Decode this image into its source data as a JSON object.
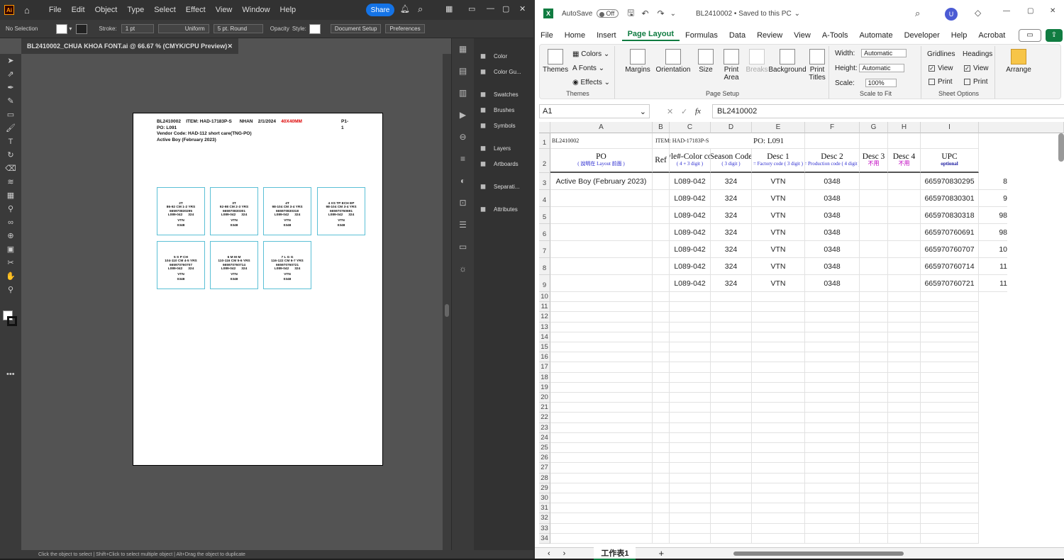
{
  "illustrator": {
    "logo": "Ai",
    "menu": [
      "File",
      "Edit",
      "Object",
      "Type",
      "Select",
      "Effect",
      "View",
      "Window",
      "Help"
    ],
    "share_label": "Share",
    "control": {
      "selection": "No Selection",
      "stroke_label": "Stroke:",
      "stroke_value": "1 pt",
      "stroke_style": "Uniform",
      "brush": "5 pt. Round",
      "opacity_label": "Opacity",
      "style_label": "Style:",
      "doc_setup": "Document Setup",
      "preferences": "Preferences"
    },
    "doc_tab": "BL2410002_CHUA KHOA FONT.ai @ 66.67 % (CMYK/CPU Preview)",
    "panels": [
      {
        "icon": "color-icon",
        "label": "Color"
      },
      {
        "icon": "color-guide-icon",
        "label": "Color Gu..."
      },
      {
        "icon": "swatches-icon",
        "label": "Swatches"
      },
      {
        "icon": "brushes-icon",
        "label": "Brushes"
      },
      {
        "icon": "symbols-icon",
        "label": "Symbols"
      },
      {
        "icon": "layers-icon",
        "label": "Layers"
      },
      {
        "icon": "artboards-icon",
        "label": "Artboards"
      },
      {
        "icon": "separations-icon",
        "label": "Separati..."
      },
      {
        "icon": "attributes-icon",
        "label": "Attributes"
      }
    ],
    "status": "Click the object to select  |  Shift+Click to select multiple object  |  Alt+Drag the object to duplicate",
    "artboard": {
      "line1_bl": "BL2410002",
      "line1_item": "ITEM: HAD-17183P-S",
      "line1_nhan": "NHAN",
      "line1_date": "2/1/2024",
      "line1_size": "40X40MM",
      "line1_page": "P1-1",
      "line2": "PO: L091",
      "line3": "Vendor Code: HAD-112 short care(TNG-PO)",
      "line4": "Active Boy (February 2023)",
      "labels": [
        {
          "size": "2T",
          "range": "86-92 CM 1-2 YRS",
          "upc": "665970830295",
          "style": "L089-042",
          "season": "324",
          "vtn": "VTN",
          "code": "0348"
        },
        {
          "size": "3T",
          "range": "92-98 CM 2-3 YRS",
          "upc": "665970830301",
          "style": "L089-042",
          "season": "324",
          "vtn": "VTN",
          "code": "0348"
        },
        {
          "size": "4T",
          "range": "98-104 CM 3-4 YRS",
          "upc": "665970830318",
          "style": "L089-042",
          "season": "324",
          "vtn": "VTN",
          "code": "0348"
        },
        {
          "size": "4 XS TP ECH EP",
          "range": "98-104 CM 3-4 YRS",
          "upc": "665970760691",
          "style": "L089-042",
          "season": "324",
          "vtn": "VTN",
          "code": "0348"
        },
        {
          "size": "5 S P CH",
          "range": "104-110 CM 4-5 YRS",
          "upc": "665970760707",
          "style": "L089-042",
          "season": "324",
          "vtn": "VTN",
          "code": "0348"
        },
        {
          "size": "6 M M M",
          "range": "110-116 CM 5-6 YRS",
          "upc": "665970760714",
          "style": "L089-042",
          "season": "324",
          "vtn": "VTN",
          "code": "0348"
        },
        {
          "size": "7 L G G",
          "range": "116-122 CM 6-7 YRS",
          "upc": "665970760721",
          "style": "L089-042",
          "season": "324",
          "vtn": "VTN",
          "code": "0348"
        }
      ]
    }
  },
  "excel": {
    "logo": "X",
    "autosave": "AutoSave",
    "autosave_state": "Off",
    "file_title": "BL2410002  •  Saved to this PC",
    "user_initial": "U",
    "tabs": [
      "File",
      "Home",
      "Insert",
      "Page Layout",
      "Formulas",
      "Data",
      "Review",
      "View",
      "A-Tools",
      "Automate",
      "Developer",
      "Help",
      "Acrobat"
    ],
    "active_tab": "Page Layout",
    "ribbon": {
      "themes": "Themes",
      "colors": "Colors",
      "fonts": "Fonts",
      "effects": "Effects",
      "themes_group": "Themes",
      "margins": "Margins",
      "orientation": "Orientation",
      "size": "Size",
      "print_area": "Print Area",
      "breaks": "Breaks",
      "background": "Background",
      "print_titles": "Print Titles",
      "page_setup_group": "Page Setup",
      "width_label": "Width:",
      "width_val": "Automatic",
      "height_label": "Height:",
      "height_val": "Automatic",
      "scale_label": "Scale:",
      "scale_val": "100%",
      "scale_group": "Scale to Fit",
      "gridlines": "Gridlines",
      "headings": "Headings",
      "view": "View",
      "print": "Print",
      "sheet_options_group": "Sheet Options",
      "arrange": "Arrange"
    },
    "namebox": "A1",
    "formula": "BL2410002",
    "columns": [
      "A",
      "B",
      "C",
      "D",
      "E",
      "F",
      "G",
      "H",
      "I"
    ],
    "row1": {
      "a": "BL2410002",
      "c": "ITEM: HAD-17183P-S",
      "e": "PO: L091"
    },
    "row2": [
      {
        "main": "PO",
        "sub": "( 說明在 Layout 前面 )"
      },
      {
        "main": "Ref",
        "sub": ""
      },
      {
        "main": "Style#-Color code",
        "sub": "( 4 + 3 digit )"
      },
      {
        "main": "Season Code",
        "sub": "( 3 digit )"
      },
      {
        "main": "Desc 1",
        "sub": "= Factory code ( 3 digit )"
      },
      {
        "main": "Desc 2",
        "sub": "= Production code ( 4 digit )"
      },
      {
        "main": "Desc 3",
        "sub": "不用"
      },
      {
        "main": "Desc 4",
        "sub": "不用"
      },
      {
        "main": "UPC",
        "sub": "optional"
      }
    ],
    "data_rows": [
      {
        "po": "Active Boy (February 2023)",
        "style": "L089-042",
        "season": "324",
        "d1": "VTN",
        "d2": "0348",
        "upc": "665970830295",
        "extra": "8"
      },
      {
        "po": "",
        "style": "L089-042",
        "season": "324",
        "d1": "VTN",
        "d2": "0348",
        "upc": "665970830301",
        "extra": "9"
      },
      {
        "po": "",
        "style": "L089-042",
        "season": "324",
        "d1": "VTN",
        "d2": "0348",
        "upc": "665970830318",
        "extra": "98"
      },
      {
        "po": "",
        "style": "L089-042",
        "season": "324",
        "d1": "VTN",
        "d2": "0348",
        "upc": "665970760691",
        "extra": "98"
      },
      {
        "po": "",
        "style": "L089-042",
        "season": "324",
        "d1": "VTN",
        "d2": "0348",
        "upc": "665970760707",
        "extra": "10"
      },
      {
        "po": "",
        "style": "L089-042",
        "season": "324",
        "d1": "VTN",
        "d2": "0348",
        "upc": "665970760714",
        "extra": "11"
      },
      {
        "po": "",
        "style": "L089-042",
        "season": "324",
        "d1": "VTN",
        "d2": "0348",
        "upc": "665970760721",
        "extra": "11"
      }
    ],
    "empty_rows": [
      "10",
      "11",
      "12",
      "13",
      "14",
      "15",
      "16",
      "17",
      "18",
      "19",
      "20",
      "21",
      "22",
      "23",
      "24",
      "25",
      "26",
      "27",
      "28",
      "29",
      "30",
      "31",
      "32",
      "33",
      "34"
    ],
    "sheet_tab": "工作表1"
  }
}
